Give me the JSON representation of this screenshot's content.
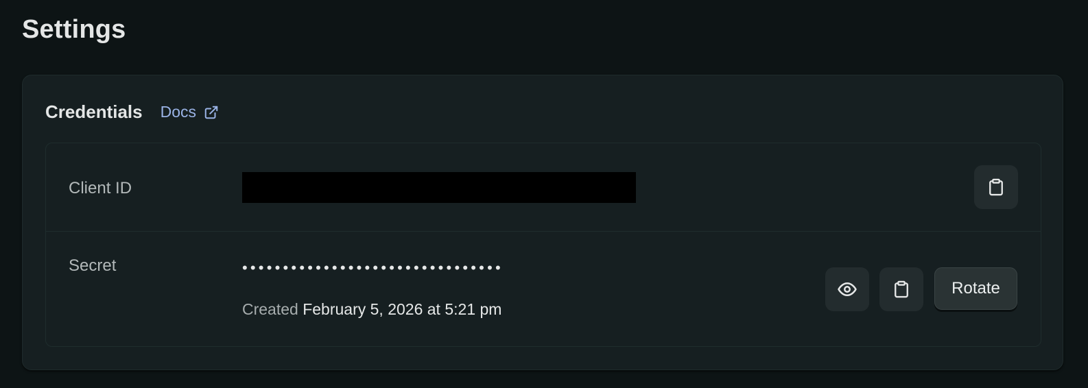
{
  "page": {
    "title": "Settings"
  },
  "credentials": {
    "title": "Credentials",
    "docs_label": "Docs",
    "docs_icon": "external-link-icon",
    "client_id": {
      "label": "Client ID",
      "value_redacted": true,
      "copy_icon": "clipboard-icon"
    },
    "secret": {
      "label": "Secret",
      "masked_value": "••••••••••••••••••••••••••••••••",
      "created_label": "Created",
      "created_value": "February 5, 2026 at 5:21 pm",
      "reveal_icon": "eye-icon",
      "copy_icon": "clipboard-icon",
      "rotate_label": "Rotate"
    }
  },
  "colors": {
    "background": "#0d1415",
    "card": "#161f21",
    "link": "#9ab3e6",
    "icon_button": "#232c2e"
  }
}
